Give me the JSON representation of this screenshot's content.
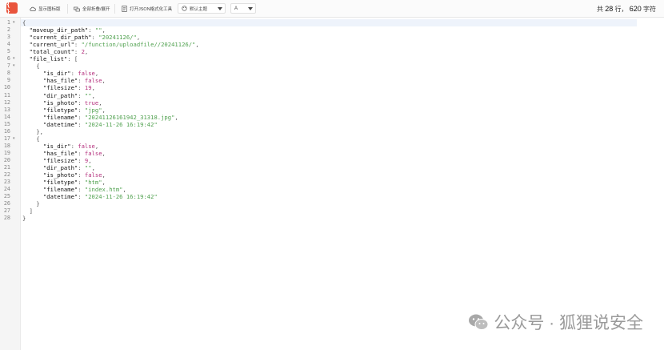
{
  "toolbar": {
    "buttons": [
      {
        "label": "显示图标版"
      },
      {
        "label": "全部折叠/展开"
      },
      {
        "label": "打开JSON格式化工具"
      }
    ],
    "theme": "默认主题",
    "font": "A"
  },
  "stats": {
    "prefix": "共",
    "lines": "28",
    "lines_unit": "行，",
    "chars": "620",
    "chars_unit": "字符"
  },
  "editor": {
    "lines": [
      [
        [
          "p",
          "{"
        ]
      ],
      [
        [
          "p",
          "  "
        ],
        [
          "k",
          "\"moveup_dir_path\""
        ],
        [
          "p",
          ": "
        ],
        [
          "s",
          "\"\""
        ],
        [
          "p",
          ","
        ]
      ],
      [
        [
          "p",
          "  "
        ],
        [
          "k",
          "\"current_dir_path\""
        ],
        [
          "p",
          ": "
        ],
        [
          "s",
          "\"20241126/\""
        ],
        [
          "p",
          ","
        ]
      ],
      [
        [
          "p",
          "  "
        ],
        [
          "k",
          "\"current_url\""
        ],
        [
          "p",
          ": "
        ],
        [
          "s",
          "\"/function/uploadfile//20241126/\""
        ],
        [
          "p",
          ","
        ]
      ],
      [
        [
          "p",
          "  "
        ],
        [
          "k",
          "\"total_count\""
        ],
        [
          "p",
          ": "
        ],
        [
          "n",
          "2"
        ],
        [
          "p",
          ","
        ]
      ],
      [
        [
          "p",
          "  "
        ],
        [
          "k",
          "\"file_list\""
        ],
        [
          "p",
          ": ["
        ]
      ],
      [
        [
          "p",
          "    {"
        ]
      ],
      [
        [
          "p",
          "      "
        ],
        [
          "k",
          "\"is_dir\""
        ],
        [
          "p",
          ": "
        ],
        [
          "b",
          "false"
        ],
        [
          "p",
          ","
        ]
      ],
      [
        [
          "p",
          "      "
        ],
        [
          "k",
          "\"has_file\""
        ],
        [
          "p",
          ": "
        ],
        [
          "b",
          "false"
        ],
        [
          "p",
          ","
        ]
      ],
      [
        [
          "p",
          "      "
        ],
        [
          "k",
          "\"filesize\""
        ],
        [
          "p",
          ": "
        ],
        [
          "n",
          "19"
        ],
        [
          "p",
          ","
        ]
      ],
      [
        [
          "p",
          "      "
        ],
        [
          "k",
          "\"dir_path\""
        ],
        [
          "p",
          ": "
        ],
        [
          "s",
          "\"\""
        ],
        [
          "p",
          ","
        ]
      ],
      [
        [
          "p",
          "      "
        ],
        [
          "k",
          "\"is_photo\""
        ],
        [
          "p",
          ": "
        ],
        [
          "b",
          "true"
        ],
        [
          "p",
          ","
        ]
      ],
      [
        [
          "p",
          "      "
        ],
        [
          "k",
          "\"filetype\""
        ],
        [
          "p",
          ": "
        ],
        [
          "s",
          "\"jpg\""
        ],
        [
          "p",
          ","
        ]
      ],
      [
        [
          "p",
          "      "
        ],
        [
          "k",
          "\"filename\""
        ],
        [
          "p",
          ": "
        ],
        [
          "s",
          "\"20241126161942_31318.jpg\""
        ],
        [
          "p",
          ","
        ]
      ],
      [
        [
          "p",
          "      "
        ],
        [
          "k",
          "\"datetime\""
        ],
        [
          "p",
          ": "
        ],
        [
          "s",
          "\"2024-11-26 16:19:42\""
        ]
      ],
      [
        [
          "p",
          "    },"
        ]
      ],
      [
        [
          "p",
          "    {"
        ]
      ],
      [
        [
          "p",
          "      "
        ],
        [
          "k",
          "\"is_dir\""
        ],
        [
          "p",
          ": "
        ],
        [
          "b",
          "false"
        ],
        [
          "p",
          ","
        ]
      ],
      [
        [
          "p",
          "      "
        ],
        [
          "k",
          "\"has_file\""
        ],
        [
          "p",
          ": "
        ],
        [
          "b",
          "false"
        ],
        [
          "p",
          ","
        ]
      ],
      [
        [
          "p",
          "      "
        ],
        [
          "k",
          "\"filesize\""
        ],
        [
          "p",
          ": "
        ],
        [
          "n",
          "9"
        ],
        [
          "p",
          ","
        ]
      ],
      [
        [
          "p",
          "      "
        ],
        [
          "k",
          "\"dir_path\""
        ],
        [
          "p",
          ": "
        ],
        [
          "s",
          "\"\""
        ],
        [
          "p",
          ","
        ]
      ],
      [
        [
          "p",
          "      "
        ],
        [
          "k",
          "\"is_photo\""
        ],
        [
          "p",
          ": "
        ],
        [
          "b",
          "false"
        ],
        [
          "p",
          ","
        ]
      ],
      [
        [
          "p",
          "      "
        ],
        [
          "k",
          "\"filetype\""
        ],
        [
          "p",
          ": "
        ],
        [
          "s",
          "\"htm\""
        ],
        [
          "p",
          ","
        ]
      ],
      [
        [
          "p",
          "      "
        ],
        [
          "k",
          "\"filename\""
        ],
        [
          "p",
          ": "
        ],
        [
          "s",
          "\"index.htm\""
        ],
        [
          "p",
          ","
        ]
      ],
      [
        [
          "p",
          "      "
        ],
        [
          "k",
          "\"datetime\""
        ],
        [
          "p",
          ": "
        ],
        [
          "s",
          "\"2024-11-26 16:19:42\""
        ]
      ],
      [
        [
          "p",
          "    }"
        ]
      ],
      [
        [
          "p",
          "  ]"
        ]
      ],
      [
        [
          "p",
          "}"
        ]
      ]
    ],
    "line_numbers": [
      "1",
      "2",
      "3",
      "4",
      "5",
      "6",
      "7",
      "8",
      "9",
      "10",
      "11",
      "12",
      "13",
      "14",
      "15",
      "16",
      "17",
      "18",
      "19",
      "20",
      "21",
      "22",
      "23",
      "24",
      "25",
      "26",
      "27",
      "28"
    ],
    "fold_marker": "▾",
    "fold_lines": [
      1,
      6,
      7,
      17
    ]
  },
  "watermark": {
    "text": "公众号 · 狐狸说安全"
  },
  "colors": {
    "logo": "#e9543c",
    "key": "#111111",
    "string": "#50a14f",
    "number_bool": "#b4307d",
    "active_line": "#eef3fb"
  }
}
